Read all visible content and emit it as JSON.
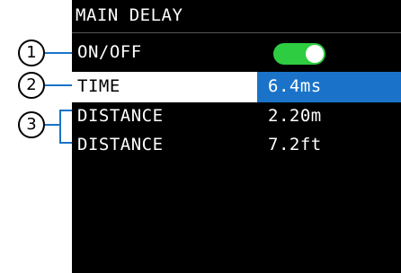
{
  "screen": {
    "title": "MAIN DELAY",
    "rows": [
      {
        "label": "ON/OFF",
        "toggle_state": "on",
        "toggle_color": "#2ecc40"
      },
      {
        "label": "TIME",
        "value": "6.4ms",
        "highlight_color": "#1a73c8"
      },
      {
        "label": "DISTANCE",
        "value": "2.20m"
      },
      {
        "label": "DISTANCE",
        "value": "7.2ft"
      }
    ]
  },
  "callouts": {
    "one": "1",
    "two": "2",
    "three": "3"
  }
}
